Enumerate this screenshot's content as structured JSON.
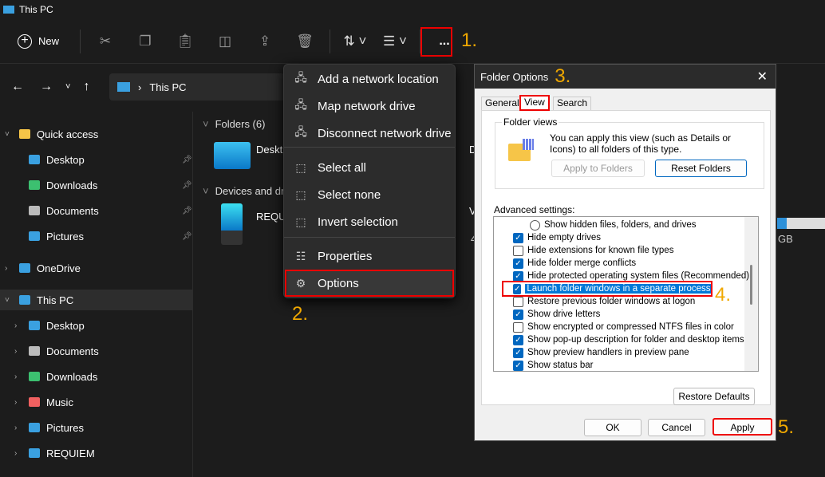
{
  "window": {
    "title": "This PC"
  },
  "toolbar": {
    "new_label": "New",
    "more_label": "..."
  },
  "address": {
    "path": "This PC"
  },
  "sidebar": {
    "items": [
      {
        "label": "Quick access",
        "level": 0,
        "pinned": false
      },
      {
        "label": "Desktop",
        "level": 1,
        "pinned": true
      },
      {
        "label": "Downloads",
        "level": 1,
        "pinned": true
      },
      {
        "label": "Documents",
        "level": 1,
        "pinned": true
      },
      {
        "label": "Pictures",
        "level": 1,
        "pinned": true
      },
      {
        "label": "OneDrive",
        "level": 0,
        "pinned": false
      },
      {
        "label": "This PC",
        "level": 0,
        "pinned": false
      },
      {
        "label": "Desktop",
        "level": 1,
        "pinned": false
      },
      {
        "label": "Documents",
        "level": 1,
        "pinned": false
      },
      {
        "label": "Downloads",
        "level": 1,
        "pinned": false
      },
      {
        "label": "Music",
        "level": 1,
        "pinned": false
      },
      {
        "label": "Pictures",
        "level": 1,
        "pinned": false
      },
      {
        "label": "REQUIEM",
        "level": 1,
        "pinned": false
      }
    ]
  },
  "content": {
    "folders_header": "Folders (6)",
    "folder1": "Deskt",
    "folder2": "D",
    "devices_header": "Devices and dr",
    "device1": "REQU",
    "device2": "V",
    "device2_size": "4",
    "device3_size": "GB"
  },
  "menu": {
    "items": [
      "Add a network location",
      "Map network drive",
      "Disconnect network drive",
      "Select all",
      "Select none",
      "Invert selection",
      "Properties",
      "Options"
    ]
  },
  "steps": [
    "1.",
    "2.",
    "3.",
    "4.",
    "5."
  ],
  "dialog": {
    "title": "Folder Options",
    "tabs": [
      "General",
      "View",
      "Search"
    ],
    "active_tab": "View",
    "folder_views_label": "Folder views",
    "folder_views_text": "You can apply this view (such as Details or Icons) to all folders of this type.",
    "apply_to_folders": "Apply to Folders",
    "reset_folders": "Reset Folders",
    "advanced_label": "Advanced settings:",
    "settings": [
      {
        "label": "Show hidden files, folders, and drives",
        "type": "radio",
        "checked": false
      },
      {
        "label": "Hide empty drives",
        "type": "check",
        "checked": true
      },
      {
        "label": "Hide extensions for known file types",
        "type": "check",
        "checked": false
      },
      {
        "label": "Hide folder merge conflicts",
        "type": "check",
        "checked": true
      },
      {
        "label": "Hide protected operating system files (Recommended)",
        "type": "check",
        "checked": true
      },
      {
        "label": "Launch folder windows in a separate process",
        "type": "check",
        "checked": true,
        "selected": true
      },
      {
        "label": "Restore previous folder windows at logon",
        "type": "check",
        "checked": false
      },
      {
        "label": "Show drive letters",
        "type": "check",
        "checked": true
      },
      {
        "label": "Show encrypted or compressed NTFS files in color",
        "type": "check",
        "checked": false
      },
      {
        "label": "Show pop-up description for folder and desktop items",
        "type": "check",
        "checked": true
      },
      {
        "label": "Show preview handlers in preview pane",
        "type": "check",
        "checked": true
      },
      {
        "label": "Show status bar",
        "type": "check",
        "checked": true
      }
    ],
    "restore_defaults": "Restore Defaults",
    "ok": "OK",
    "cancel": "Cancel",
    "apply": "Apply"
  }
}
